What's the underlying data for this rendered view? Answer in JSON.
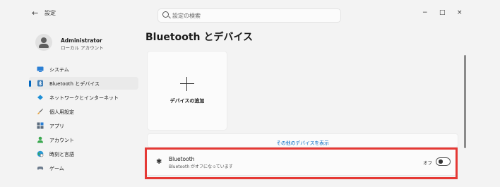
{
  "window": {
    "back_label": "←",
    "title": "設定",
    "minimize": "−",
    "maximize": "□",
    "close": "×"
  },
  "search": {
    "placeholder": "設定の検索"
  },
  "profile": {
    "name": "Administrator",
    "subtitle": "ローカル アカウント"
  },
  "sidebar": {
    "items": [
      {
        "label": "システム",
        "icon": "monitor-icon",
        "active": false
      },
      {
        "label": "Bluetooth とデバイス",
        "icon": "bluetooth-devices-icon",
        "active": true
      },
      {
        "label": "ネットワークとインターネット",
        "icon": "network-icon",
        "active": false
      },
      {
        "label": "個人用設定",
        "icon": "brush-icon",
        "active": false
      },
      {
        "label": "アプリ",
        "icon": "apps-icon",
        "active": false
      },
      {
        "label": "アカウント",
        "icon": "account-icon",
        "active": false
      },
      {
        "label": "時刻と言語",
        "icon": "globe-clock-icon",
        "active": false
      },
      {
        "label": "ゲーム",
        "icon": "gamepad-icon",
        "active": false
      }
    ]
  },
  "main": {
    "title": "Bluetooth とデバイス",
    "add_device_label": "デバイスの追加",
    "show_more_label": "その他のデバイスを表示",
    "bluetooth": {
      "name": "Bluetooth",
      "status": "Bluetooth がオフになっています",
      "toggle_state": "オフ",
      "enabled": false
    }
  },
  "colors": {
    "accent": "#0067c0",
    "highlight": "#e53935",
    "background": "#f3f3f3"
  }
}
